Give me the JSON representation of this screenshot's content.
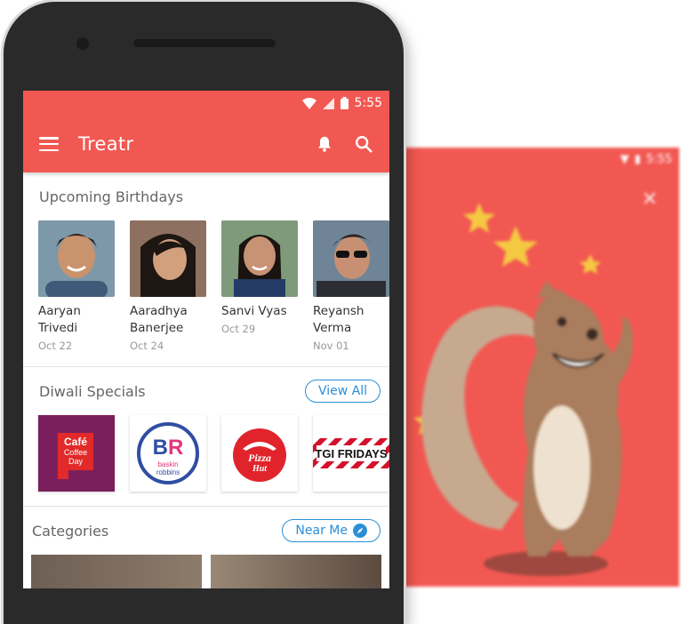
{
  "status": {
    "time": "5:55"
  },
  "app_bar": {
    "title": "Treatr"
  },
  "birthdays": {
    "heading": "Upcoming Birthdays",
    "people": [
      {
        "name": "Aaryan Trivedi",
        "date": "Oct 22"
      },
      {
        "name": "Aaradhya Banerjee",
        "date": "Oct 24"
      },
      {
        "name": "Sanvi Vyas",
        "date": "Oct 29"
      },
      {
        "name": "Reyansh Verma",
        "date": "Nov 01"
      }
    ]
  },
  "specials": {
    "heading": "Diwali Specials",
    "view_all_label": "View All",
    "brands": [
      {
        "name": "Café Coffee Day",
        "logo_text": "Café Coffee Day"
      },
      {
        "name": "Baskin Robbins",
        "logo_text": "BR baskin robbins"
      },
      {
        "name": "Pizza Hut",
        "logo_text": "Pizza Hut"
      },
      {
        "name": "TGI Fridays",
        "logo_text": "TGI FRIDAYS"
      }
    ]
  },
  "categories": {
    "heading": "Categories",
    "near_me_label": "Near Me"
  },
  "colors": {
    "brand_red": "#f25852",
    "accent_blue": "#2b8fd6"
  }
}
